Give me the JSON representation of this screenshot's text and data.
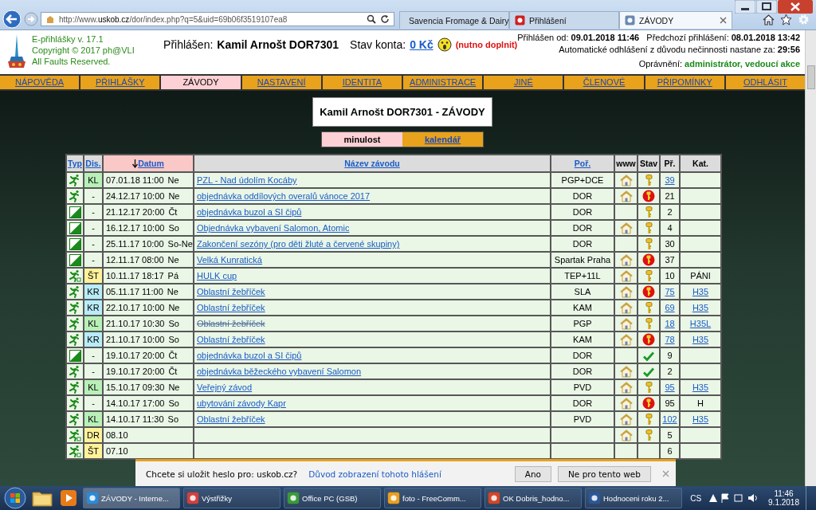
{
  "browser": {
    "address": "http://www.**uskob.cz**/dor/index.php?q=5&uid=69b06f3519107ea8",
    "tabs": [
      {
        "label": "Savencia Fromage & Dairy",
        "selected": false
      },
      {
        "label": "Přihlášení",
        "selected": false
      },
      {
        "label": "ZÁVODY",
        "selected": true
      }
    ]
  },
  "header": {
    "app_lines": [
      "E-přihlášky v. 17.1",
      "Copyright © 2017 ph@VLI",
      "All Faults Reserved."
    ],
    "user_label": "Přihlášen:",
    "user_name": "Kamil Arnošt DOR7301",
    "balance_label": "Stav konta:",
    "balance": "0 Kč",
    "balance_note": "(nutno doplnit)",
    "login_info": "Přihlášen od: **09.01.2018 11:46**   Předchozí přihlášení: **08.01.2018 13:42**",
    "logout_info": "Automatické odhlášení z důvodu nečinnosti nastane za: **29:56**",
    "rights_label": "Oprávnění:",
    "rights": "administrátor, vedoucí akce"
  },
  "nav": [
    {
      "label": "NÁPOVĚDA",
      "selected": false
    },
    {
      "label": "PŘIHLÁŠKY",
      "selected": false
    },
    {
      "label": "ZÁVODY",
      "selected": true
    },
    {
      "label": "NASTAVENÍ",
      "selected": false
    },
    {
      "label": "IDENTITA",
      "selected": false
    },
    {
      "label": "ADMINISTRACE",
      "selected": false
    },
    {
      "label": "JINÉ",
      "selected": false
    },
    {
      "label": "ČLENOVÉ",
      "selected": false
    },
    {
      "label": "PŘIPOMÍNKY",
      "selected": false
    },
    {
      "label": "ODHLÁSIT",
      "selected": false
    }
  ],
  "page_title": "Kamil Arnošt DOR7301 - ZÁVODY",
  "subtabs": [
    {
      "label": "minulost",
      "selected": true
    },
    {
      "label": "kalendář",
      "selected": false
    }
  ],
  "table": {
    "columns": [
      {
        "label": "Typ",
        "link": true,
        "sorted": false
      },
      {
        "label": "Dis.",
        "link": true,
        "sorted": false
      },
      {
        "label": "Datum",
        "link": true,
        "sorted": true
      },
      {
        "label": "Název závodu",
        "link": true,
        "sorted": false
      },
      {
        "label": "Poř.",
        "link": true,
        "sorted": false
      },
      {
        "label": "www",
        "link": false,
        "sorted": false
      },
      {
        "label": "Stav",
        "link": false,
        "sorted": false
      },
      {
        "label": "Př.",
        "link": false,
        "sorted": false
      },
      {
        "label": "Kat.",
        "link": false,
        "sorted": false
      }
    ],
    "rows": [
      {
        "kind": "run",
        "dis": "KL",
        "color": "#b8f0b8",
        "date": "07.01.18 11:00",
        "day": "Ne",
        "name": "PZL - Nad údolím Kocáby",
        "cancelled": false,
        "org": "PGP+DCE",
        "www": true,
        "status": {
          "kind": "key"
        },
        "count": "39",
        "count_link": true
      },
      {
        "kind": "run",
        "dis": "-",
        "date": "24.12.17 10:00",
        "day": "Ne",
        "name": "objednávka oddílových overalů vánoce 2017",
        "cancelled": false,
        "org": "DOR",
        "www": true,
        "status": {
          "kind": "alert"
        },
        "count": "21",
        "count_link": false
      },
      {
        "kind": "box",
        "dis": "-",
        "date": "21.12.17 20:00",
        "day": "Čt",
        "name": "objednávka buzol a SI čipů",
        "cancelled": false,
        "org": "DOR",
        "www": false,
        "status": {
          "kind": "key"
        },
        "count": "2",
        "count_link": false
      },
      {
        "kind": "box",
        "dis": "-",
        "date": "16.12.17 10:00",
        "day": "So",
        "name": "Objednávka vybavení Salomon, Atomic",
        "cancelled": false,
        "org": "DOR",
        "www": true,
        "status": {
          "kind": "key"
        },
        "count": "4",
        "count_link": false
      },
      {
        "kind": "box",
        "dis": "-",
        "date": "25.11.17 10:00",
        "day": "So-Ne",
        "name": "Zakončení sezóny (pro děti žluté a červené skupiny)",
        "cancelled": false,
        "org": "DOR",
        "www": false,
        "status": {
          "kind": "key"
        },
        "count": "30",
        "count_link": false
      },
      {
        "kind": "box",
        "dis": "-",
        "date": "12.11.17 08:00",
        "day": "Ne",
        "name": "Velká Kunratická",
        "cancelled": false,
        "org": "Spartak Praha",
        "www": true,
        "status": {
          "kind": "alert"
        },
        "count": "37",
        "count_link": false
      },
      {
        "kind": "run-badge",
        "dis": "ŠT",
        "color": "#fff29a",
        "date": "10.11.17 18:17",
        "day": "Pá",
        "name": "HULK cup",
        "cancelled": false,
        "org": "TEP+11L",
        "www": true,
        "status": {
          "kind": "key"
        },
        "count": "10",
        "count_link": false,
        "kat": "PÁNI",
        "kat_link": false
      },
      {
        "kind": "run",
        "dis": "KR",
        "color": "#b8ecf8",
        "date": "05.11.17 11:00",
        "day": "Ne",
        "name": "Oblastní žebříček",
        "cancelled": false,
        "org": "SLA",
        "www": true,
        "status": {
          "kind": "alert"
        },
        "count": "75",
        "count_link": true,
        "kat": "H35",
        "kat_link": true
      },
      {
        "kind": "run",
        "dis": "KR",
        "color": "#b8ecf8",
        "date": "22.10.17 10:00",
        "day": "Ne",
        "name": "Oblastní žebříček",
        "cancelled": false,
        "org": "KAM",
        "www": true,
        "status": {
          "kind": "key"
        },
        "count": "69",
        "count_link": true,
        "kat": "H35",
        "kat_link": true
      },
      {
        "kind": "run",
        "dis": "KL",
        "color": "#b8f0b8",
        "date": "21.10.17 10:30",
        "day": "So",
        "name": "Oblastní žebříček",
        "cancelled": true,
        "org": "PGP",
        "www": true,
        "status": {
          "kind": "key"
        },
        "count": "18",
        "count_link": true,
        "kat": "H35L",
        "kat_link": true
      },
      {
        "kind": "run",
        "dis": "KR",
        "color": "#b8ecf8",
        "date": "21.10.17 10:00",
        "day": "So",
        "name": "Oblastní žebříček",
        "cancelled": false,
        "org": "KAM",
        "www": true,
        "status": {
          "kind": "alert"
        },
        "count": "78",
        "count_link": true,
        "kat": "H35",
        "kat_link": true
      },
      {
        "kind": "box",
        "dis": "-",
        "date": "19.10.17 20:00",
        "day": "Čt",
        "name": "objednávka buzol a SI čipů",
        "cancelled": false,
        "org": "DOR",
        "www": false,
        "status": {
          "kind": "check"
        },
        "count": "9",
        "count_link": false
      },
      {
        "kind": "run",
        "dis": "-",
        "date": "19.10.17 20:00",
        "day": "Čt",
        "name": "objednávka běžeckého vybavení Salomon",
        "cancelled": false,
        "org": "DOR",
        "www": true,
        "status": {
          "kind": "check"
        },
        "count": "2",
        "count_link": false
      },
      {
        "kind": "run",
        "dis": "KL",
        "color": "#b8f0b8",
        "date": "15.10.17 09:30",
        "day": "Ne",
        "name": "Veřejný závod",
        "cancelled": false,
        "org": "PVD",
        "www": true,
        "status": {
          "kind": "key"
        },
        "count": "95",
        "count_link": true,
        "kat": "H35",
        "kat_link": true
      },
      {
        "kind": "run",
        "dis": "-",
        "date": "14.10.17 17:00",
        "day": "So",
        "name": "ubytování závody Kapr",
        "cancelled": false,
        "org": "DOR",
        "www": true,
        "status": {
          "kind": "alert"
        },
        "count": "95",
        "count_link": false,
        "kat": "H",
        "kat_link": false
      },
      {
        "kind": "run",
        "dis": "KL",
        "color": "#b8f0b8",
        "date": "14.10.17 11:30",
        "day": "So",
        "name": "Oblastní žebříček",
        "cancelled": false,
        "org": "PVD",
        "www": true,
        "status": {
          "kind": "key"
        },
        "count": "102",
        "count_link": true,
        "kat": "H35",
        "kat_link": true
      },
      {
        "kind": "run-badge",
        "dis": "DR",
        "color": "#fff29a",
        "date": "08.10",
        "www": true,
        "status": {
          "kind": "key"
        },
        "count": "5",
        "count_link": false
      },
      {
        "kind": "run-badge",
        "dis": "ŠT",
        "color": "#fff29a",
        "date": "07.10",
        "count": "6",
        "count_link": false
      }
    ]
  },
  "password_bar": {
    "question": "Chcete si uložit heslo pro: uskob.cz?",
    "link": "Důvod zobrazení tohoto hlášení",
    "buttons": [
      "Ano",
      "Ne pro tento web"
    ]
  },
  "taskbar": {
    "tasks": [
      {
        "label": "ZÁVODY - Interne...",
        "selected": true
      },
      {
        "label": "Výstřižky",
        "selected": false
      },
      {
        "label": "Office PC (GSB)",
        "selected": false
      },
      {
        "label": "foto - FreeComm...",
        "selected": false
      },
      {
        "label": "OK Dobris_hodno...",
        "selected": false
      },
      {
        "label": "Hodnoceni roku 2...",
        "selected": false
      }
    ],
    "language": "CS",
    "time": "11:46",
    "date": "9.1.2018"
  }
}
